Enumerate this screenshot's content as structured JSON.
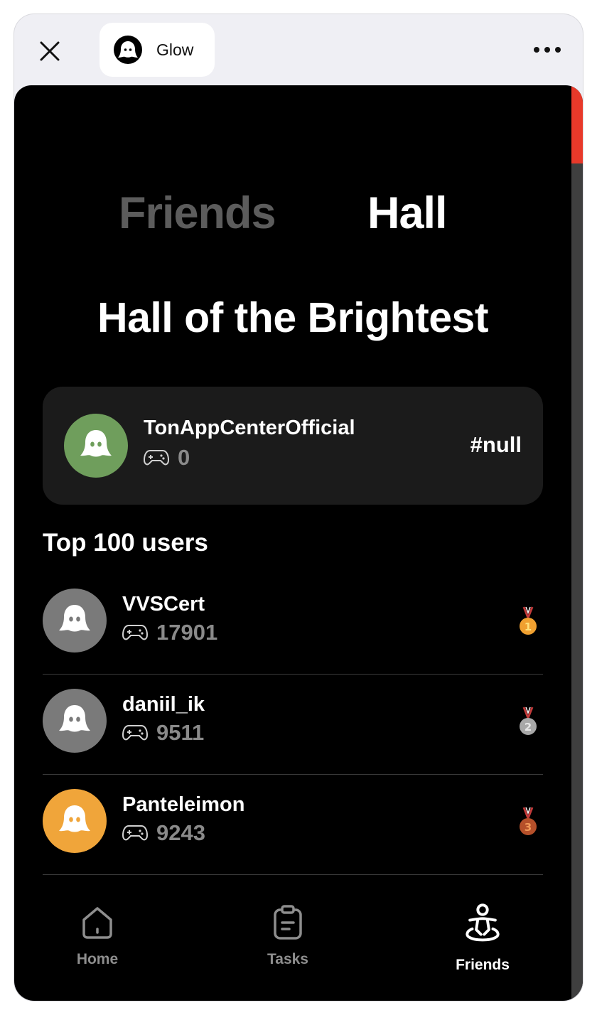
{
  "app": {
    "name": "Glow",
    "logo_icon": "ghost-logo-icon"
  },
  "colors": {
    "accent_scroll": "#e8392a",
    "my_avatar": "#6f9e5c",
    "avatar_gray": "#7a7a7a",
    "avatar_orange": "#f0a53a",
    "medal_gold": "#f0a030",
    "medal_silver": "#a8a8a8",
    "medal_bronze": "#b5502a"
  },
  "tabs": [
    {
      "label": "Friends",
      "active": false
    },
    {
      "label": "Hall",
      "active": true
    }
  ],
  "hall": {
    "title": "Hall of the Brightest",
    "me": {
      "name": "TonAppCenterOfficial",
      "score": "0",
      "rank": "#null",
      "icon": "gamepad-icon"
    },
    "top_heading": "Top 100 users",
    "users": [
      {
        "name": "VVSCert",
        "score": "17901",
        "medal": "1",
        "medal_icon": "gold-medal-icon"
      },
      {
        "name": "daniil_ik",
        "score": "9511",
        "medal": "2",
        "medal_icon": "silver-medal-icon"
      },
      {
        "name": "Panteleimon",
        "score": "9243",
        "medal": "3",
        "medal_icon": "bronze-medal-icon"
      }
    ]
  },
  "nav": {
    "home": {
      "label": "Home",
      "icon": "home-icon"
    },
    "tasks": {
      "label": "Tasks",
      "icon": "clipboard-icon"
    },
    "friends": {
      "label": "Friends",
      "icon": "friends-icon"
    }
  }
}
